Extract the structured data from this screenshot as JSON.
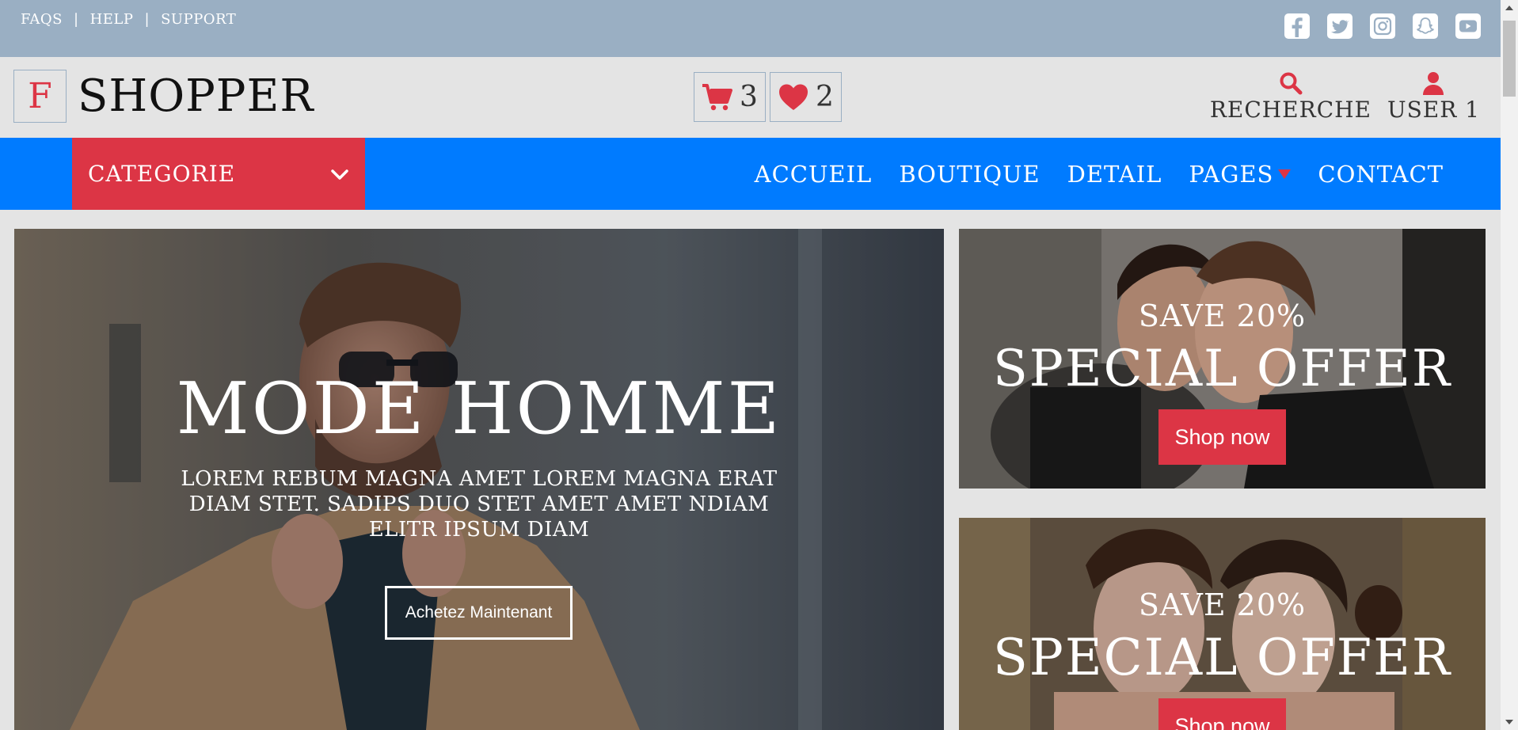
{
  "topbar": {
    "links": [
      "FAQS",
      "HELP",
      "SUPPORT"
    ],
    "separator": "|",
    "social_icons": [
      "facebook-icon",
      "twitter-icon",
      "instagram-icon",
      "snapchat-icon",
      "youtube-icon"
    ]
  },
  "header": {
    "logo_letter": "F",
    "logo_text": "SHOPPER",
    "cart_count": "3",
    "wishlist_count": "2",
    "search_label": "RECHERCHE",
    "user_label": "USER 1"
  },
  "nav": {
    "category_label": "CATEGORIE",
    "links": [
      "ACCUEIL",
      "BOUTIQUE",
      "DETAIL",
      "PAGES",
      "CONTACT"
    ]
  },
  "hero": {
    "title": "MODE HOMME",
    "subtitle": "LOREM REBUM MAGNA AMET LOREM MAGNA ERAT DIAM STET. SADIPS DUO STET AMET AMET NDIAM ELITR IPSUM DIAM",
    "button": "Achetez Maintenant"
  },
  "offers": [
    {
      "save": "SAVE 20%",
      "title": "SPECIAL OFFER",
      "button": "Shop now"
    },
    {
      "save": "SAVE 20%",
      "title": "SPECIAL OFFER",
      "button": "Shop now"
    }
  ],
  "colors": {
    "topbar": "#9aafc3",
    "accent_red": "#dc3545",
    "nav_blue": "#007bff",
    "background": "#e4e4e4"
  }
}
